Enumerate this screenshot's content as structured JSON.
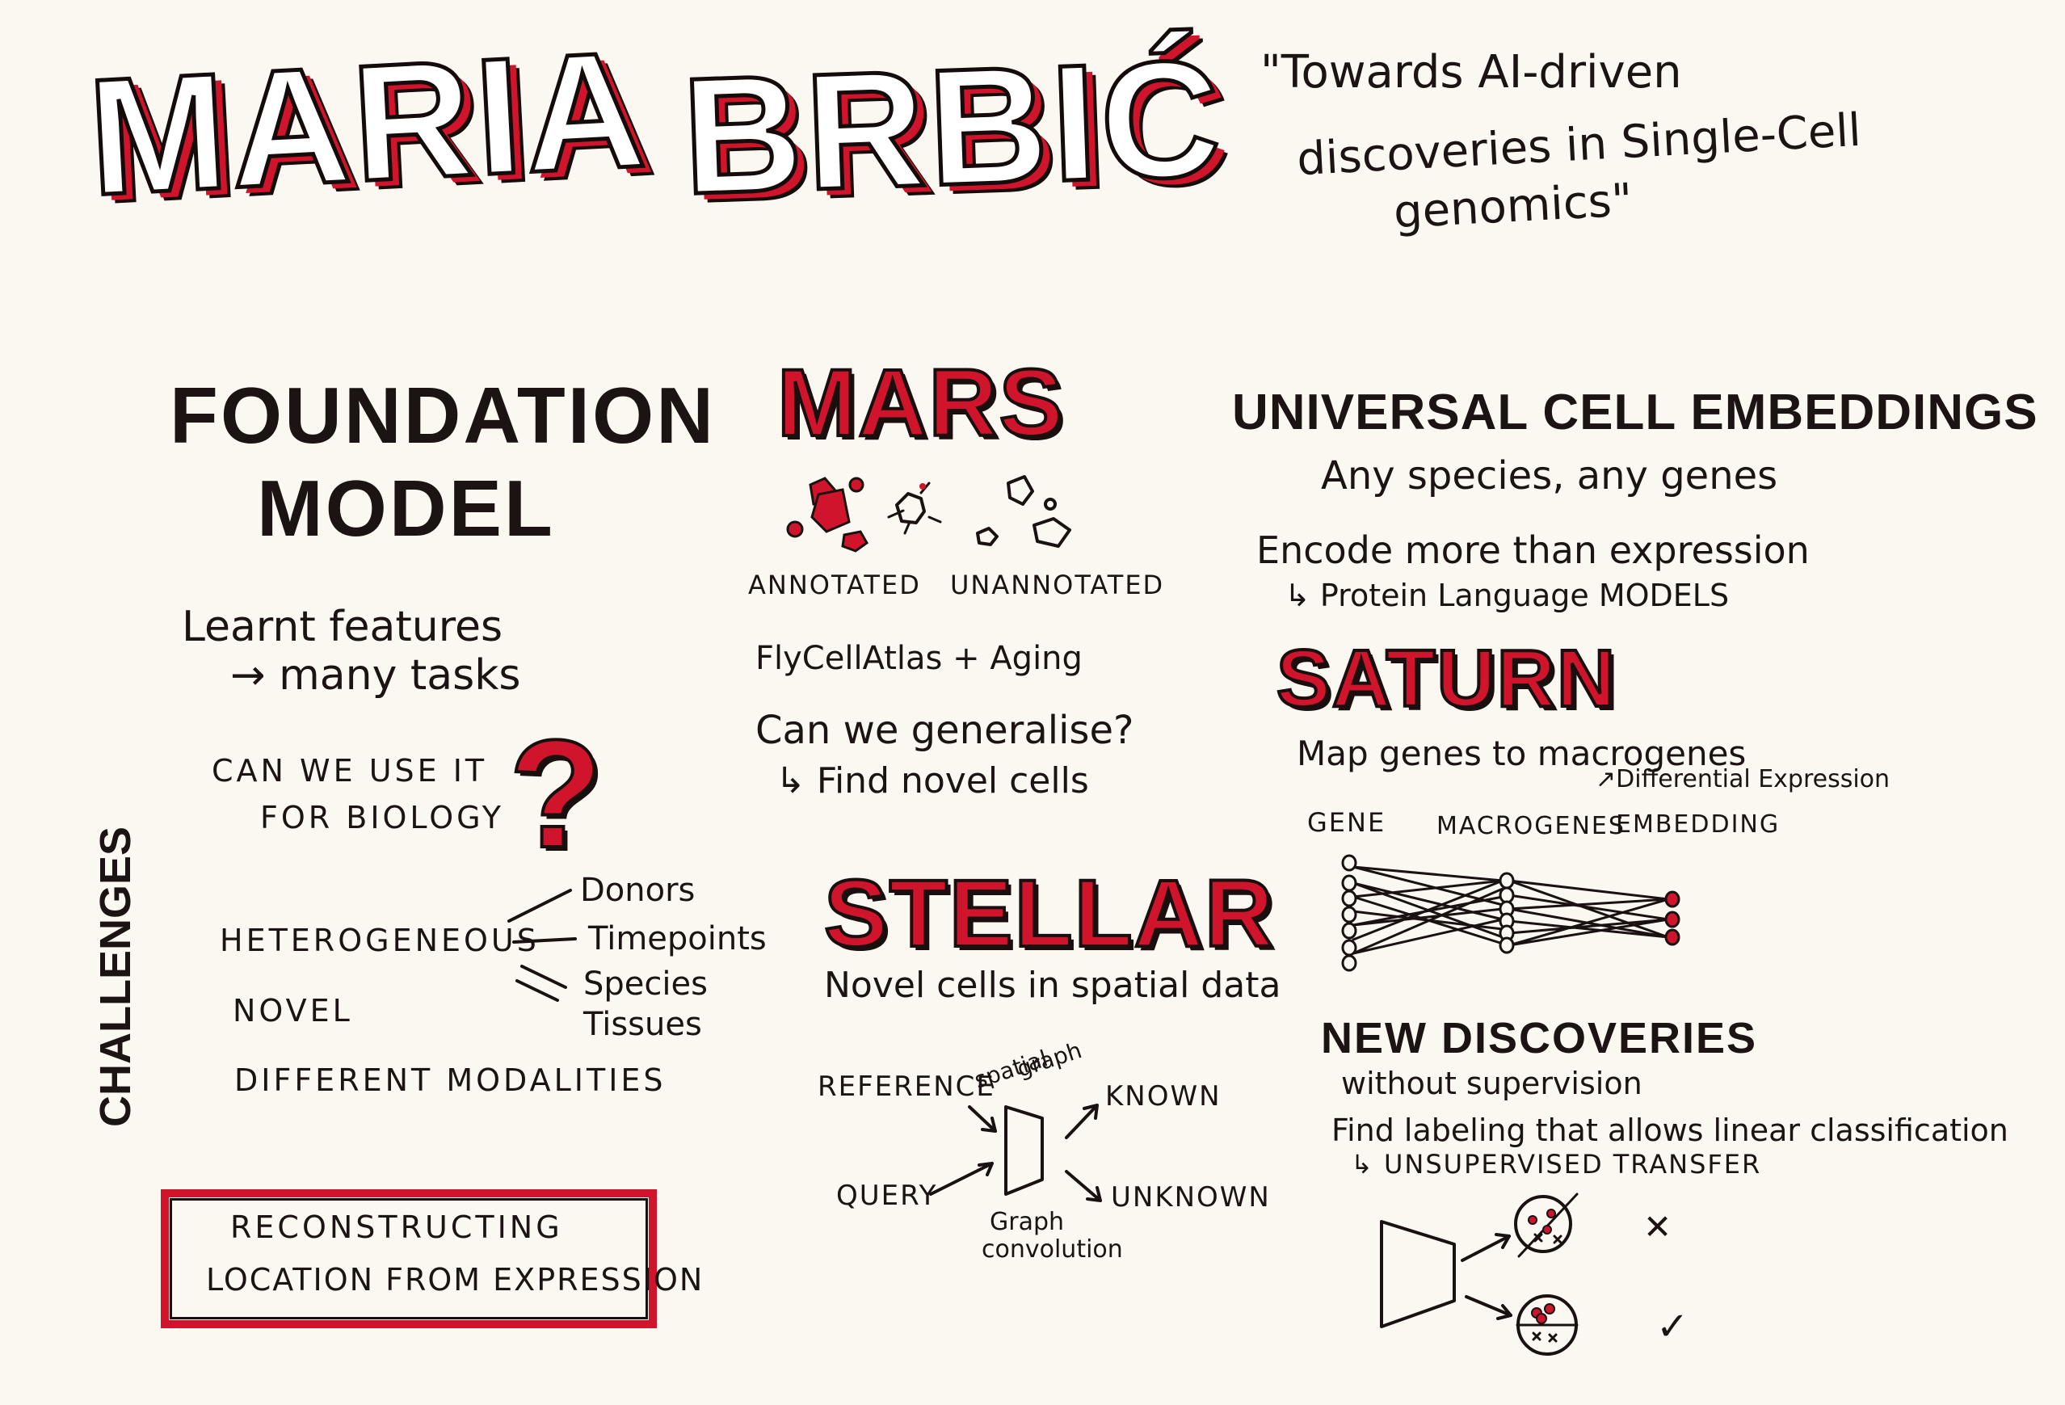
{
  "header": {
    "speaker_first": "MARIA",
    "speaker_last": "BRBIĆ",
    "talk_title_lines": [
      "\"Towards AI-driven",
      "discoveries in Single-Cell",
      "genomics\""
    ]
  },
  "foundation": {
    "title_lines": [
      "FOUNDATION",
      "MODEL"
    ],
    "features_lines": [
      "Learnt features",
      "→ many tasks"
    ],
    "question_lines": [
      "CAN WE USE IT",
      "FOR BIOLOGY"
    ],
    "question_mark": "?",
    "challenges_label": "CHALLENGES",
    "challenges": [
      "HETEROGENEOUS",
      "NOVEL",
      "DIFFERENT MODALITIES"
    ],
    "heterogeneity_types": [
      "Donors",
      "Timepoints",
      "Species",
      "Tissues"
    ],
    "box_lines": [
      "RECONSTRUCTING",
      "LOCATION FROM EXPRESSION"
    ]
  },
  "mars": {
    "title": "MARS",
    "annotated_label": "ANNOTATED",
    "unannotated_label": "UNANNOTATED",
    "dataset": "FlyCellAtlas + Aging",
    "question_lines": [
      "Can we generalise?",
      "↳ Find novel cells"
    ]
  },
  "stellar": {
    "title": "STELLAR",
    "subtitle": "Novel cells in spatial data",
    "reference_label": "REFERENCE",
    "query_label": "QUERY",
    "spatial_graph_lines": [
      "spatial",
      "graph"
    ],
    "known_label": "KNOWN",
    "unknown_label": "UNKNOWN",
    "conv_lines": [
      "Graph",
      "convolution"
    ]
  },
  "uce": {
    "title": "UNIVERSAL CELL EMBEDDINGS",
    "subtitle": "Any species, any genes",
    "encode_lines": [
      "Encode more than expression",
      "↳ Protein Language MODELS"
    ]
  },
  "saturn": {
    "title": "SATURN",
    "map_text": "Map genes to macrogenes",
    "diff_expr": "↗Differential Expression",
    "gene_label": "GENE",
    "macrogenes_label": "MACROGENES",
    "embedding_label": "EMBEDDING"
  },
  "discoveries": {
    "title": "NEW DISCOVERIES",
    "subtitle": "without supervision",
    "find_text": "Find labeling that allows linear classification",
    "transfer_text": "↳ UNSUPERVISED TRANSFER",
    "bad_mark": "✕",
    "good_mark": "✓"
  },
  "colors": {
    "accent": "#d0142c",
    "ink": "#1a1210",
    "paper": "#fbf7f1"
  }
}
